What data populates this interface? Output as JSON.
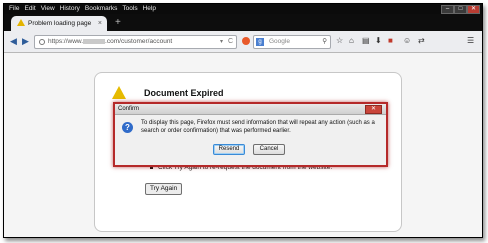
{
  "menu": [
    "File",
    "Edit",
    "View",
    "History",
    "Bookmarks",
    "Tools",
    "Help"
  ],
  "window_controls": {
    "minimize": "–",
    "maximize": "□",
    "close": "✕"
  },
  "tab": {
    "title": "Problem loading page",
    "close": "×",
    "new_tab": "+"
  },
  "nav": {
    "back": "◀",
    "forward": "▶",
    "url_prefix": "https://www.",
    "url_suffix": ".com/customer/account",
    "dropdown": "▾",
    "reload": "C",
    "search_engine": "g",
    "search_placeholder": "Google",
    "search_icon": "⚲",
    "icons": {
      "bookmark_star": "☆",
      "bookmarks_list": "▤",
      "download": "⬇",
      "home": "⌂",
      "chat": "☺",
      "addon": "■",
      "share": "⇄",
      "menu": "☰"
    }
  },
  "error_page": {
    "title": "Document Expired",
    "bullet": "Click Try Again to re-request the document from the website.",
    "try_again": "Try Again"
  },
  "dialog": {
    "title": "Confirm",
    "close": "✕",
    "icon": "?",
    "message": "To display this page, Firefox must send information that will repeat any action (such as a search or order confirmation) that was performed earlier.",
    "resend": "Resend",
    "cancel": "Cancel"
  },
  "colors": {
    "dialog_border": "#b52a2a",
    "menubar": "#0b0b0b",
    "warning": "#e6bb00",
    "question": "#2f6bc9"
  }
}
